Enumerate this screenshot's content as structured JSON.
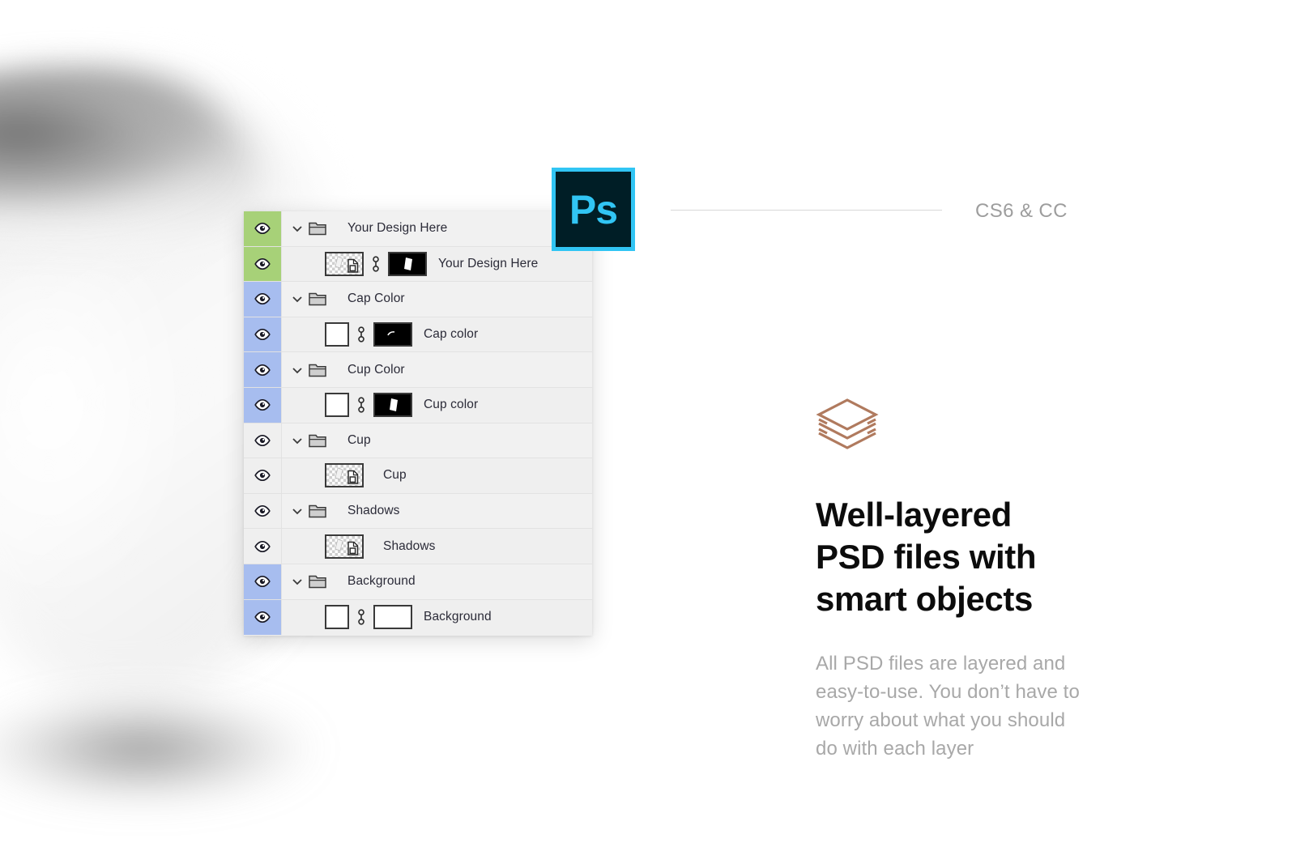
{
  "panel": {
    "name": "photoshop-layers-panel",
    "rows": [
      {
        "id": "your-design-here-group",
        "type": "group",
        "eye_color": "green",
        "name": "Your Design Here",
        "visible": true
      },
      {
        "id": "your-design-here-layer",
        "type": "smart",
        "eye_color": "green",
        "name": "Your Design Here",
        "visible": true,
        "has_mask": true,
        "mask": "dark",
        "mask_shape": "card"
      },
      {
        "id": "cap-color-group",
        "type": "group",
        "eye_color": "blue",
        "name": "Cap Color",
        "visible": true
      },
      {
        "id": "cap-color-layer",
        "type": "solid",
        "eye_color": "blue",
        "name": "Cap color",
        "visible": true,
        "has_mask": true,
        "mask": "dark",
        "mask_shape": "arc"
      },
      {
        "id": "cup-color-group",
        "type": "group",
        "eye_color": "blue",
        "name": "Cup Color",
        "visible": true
      },
      {
        "id": "cup-color-layer",
        "type": "solid",
        "eye_color": "blue",
        "name": "Cup color",
        "visible": true,
        "has_mask": true,
        "mask": "dark",
        "mask_shape": "card"
      },
      {
        "id": "cup-group",
        "type": "group",
        "eye_color": "plain",
        "name": "Cup",
        "visible": true
      },
      {
        "id": "cup-layer",
        "type": "smart",
        "eye_color": "plain",
        "name": "Cup",
        "visible": true,
        "has_mask": false
      },
      {
        "id": "shadows-group",
        "type": "group",
        "eye_color": "plain",
        "name": "Shadows",
        "visible": true
      },
      {
        "id": "shadows-layer",
        "type": "smart",
        "eye_color": "plain",
        "name": "Shadows",
        "visible": true,
        "has_mask": false
      },
      {
        "id": "background-group",
        "type": "group",
        "eye_color": "blue",
        "name": "Background",
        "visible": true
      },
      {
        "id": "background-layer",
        "type": "solid",
        "eye_color": "blue",
        "name": "Background",
        "visible": true,
        "has_mask": true,
        "mask": "white"
      }
    ]
  },
  "badge": {
    "app_abbr": "Ps",
    "icon_name": "photoshop-icon",
    "border_color": "#31c5f4",
    "fill_color": "#001e26"
  },
  "version": {
    "label": "CS6 & CC"
  },
  "feature": {
    "icon_name": "layers-stack-icon",
    "icon_color": "#b07a5e",
    "headline": "Well-layered\nPSD files with\nsmart objects",
    "body": "All PSD files are layered and\neasy-to-use. You don’t have to\nworry about what you should\ndo with each layer"
  }
}
